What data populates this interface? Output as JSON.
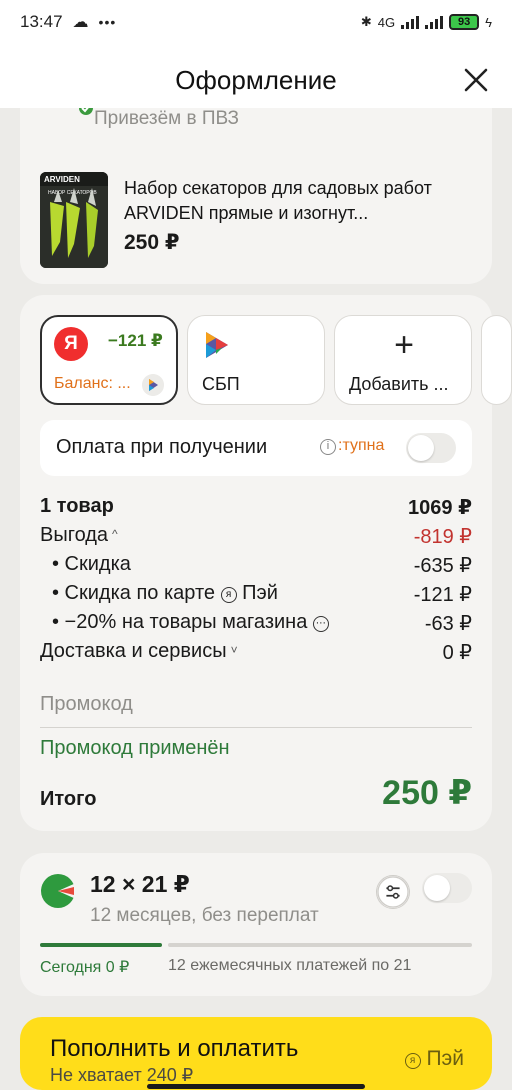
{
  "status_bar": {
    "time": "13:47",
    "network": "4G",
    "battery": "93"
  },
  "header": {
    "title": "Оформление"
  },
  "order": {
    "delivery": "Привезём в ПВЗ",
    "product_name": "Набор секаторов для садовых работ ARVIDEN прямые и изогнут...",
    "product_price": "250 ₽",
    "thumb_brand": "ARVIDEN",
    "thumb_caption": "НАБОР СЕКАТОРОВ"
  },
  "payment": {
    "methods": [
      {
        "logo": "Я",
        "amount": "−121 ₽",
        "label": "Баланс: ..."
      },
      {
        "label": "СБП"
      },
      {
        "icon": "+",
        "label": "Добавить ..."
      }
    ],
    "cash_on_delivery": {
      "label": "Оплата при получении",
      "info": ":тупна"
    }
  },
  "summary": {
    "items_label": "1 товар",
    "items_value": "1069 ₽",
    "benefit_label": "Выгода",
    "benefit_value": "-819 ₽",
    "discount_label": "• Скидка",
    "discount_value": "-635 ₽",
    "card_discount_label": "• Скидка по карте",
    "card_discount_brand": "Пэй",
    "card_discount_value": "-121 ₽",
    "store_discount_label": "• −20% на товары магазина",
    "store_discount_value": "-63 ₽",
    "delivery_label": "Доставка и сервисы",
    "delivery_value": "0 ₽",
    "promo_placeholder": "Промокод",
    "promo_applied": "Промокод применён",
    "total_label": "Итого",
    "total_value": "250 ₽"
  },
  "split": {
    "amount": "12 × 21 ₽",
    "subtitle": "12 месяцев, без переплат",
    "today": "Сегодня 0 ₽",
    "monthly": "12 ежемесячных платежей по 21"
  },
  "cta": {
    "label": "Пополнить и оплатить",
    "note": "Не хватает 240 ₽",
    "pay_brand": "Пэй"
  },
  "colors": {
    "accent_green": "#2e7a3a",
    "discount_red": "#c2332f",
    "cta_yellow": "#ffdd1a",
    "balance_orange": "#e0711b"
  }
}
